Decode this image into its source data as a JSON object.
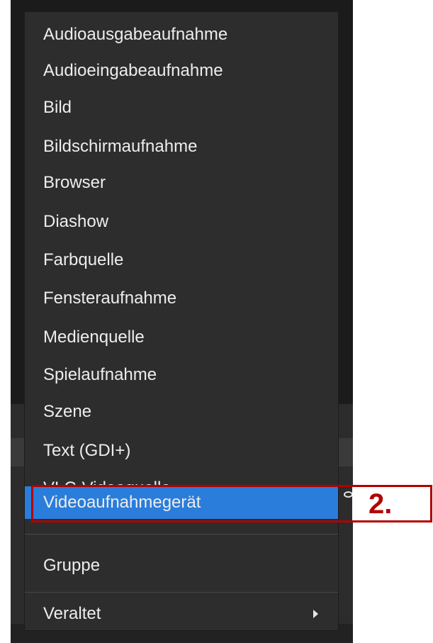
{
  "menu": {
    "items": [
      {
        "label": "Audioausgabeaufnahme"
      },
      {
        "label": "Audioeingabeaufnahme"
      },
      {
        "label": "Bild"
      },
      {
        "label": "Bildschirmaufnahme"
      },
      {
        "label": "Browser"
      },
      {
        "label": "Diashow"
      },
      {
        "label": "Farbquelle"
      },
      {
        "label": "Fensteraufnahme"
      },
      {
        "label": "Medienquelle"
      },
      {
        "label": "Spielaufnahme"
      },
      {
        "label": "Szene"
      },
      {
        "label": "Text (GDI+)"
      },
      {
        "label": "VLC-Videoquelle"
      },
      {
        "label": "Videoaufnahmegerät",
        "selected": true
      }
    ],
    "group_label": "Gruppe",
    "deprecated_label": "Veraltet",
    "deprecated_icon": "chevron-right-icon"
  },
  "annotation": {
    "label": "2.",
    "color": "#b30000"
  },
  "colors": {
    "menu_bg": "#2d2d2d",
    "selected_bg": "#2a7ddb",
    "text": "#ededed"
  }
}
